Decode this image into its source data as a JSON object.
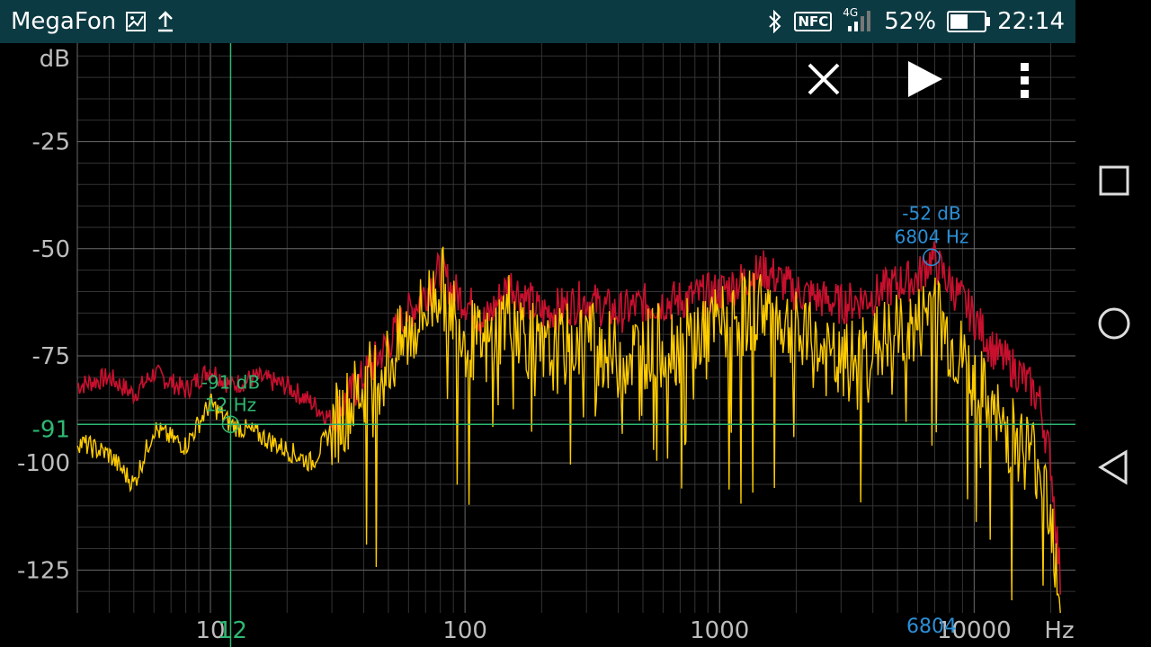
{
  "status_bar": {
    "carrier": "MegaFon",
    "network_type": "4G",
    "battery_percent": "52%",
    "battery_level": 0.52,
    "time": "22:14",
    "icons": [
      "image-icon",
      "upload-icon",
      "bluetooth-icon",
      "nfc-icon",
      "signal-icon",
      "battery-icon"
    ],
    "nfc_label": "NFC"
  },
  "toolbar": {
    "icons": [
      "close-icon",
      "play-icon",
      "more-vert-icon"
    ]
  },
  "nav_bar": {
    "icons": [
      "recents-square-icon",
      "home-circle-icon",
      "back-triangle-icon"
    ]
  },
  "colors": {
    "background": "#000000",
    "grid_major": "#6a6a6a",
    "grid_minor": "#333333",
    "peak_trace": "#c8102e",
    "live_trace": "#ffcc00",
    "cursor": "#2eb872",
    "peak_marker": "#2b8fd6",
    "axis_text": "#bdbdbd"
  },
  "cursor": {
    "db_label": "-91 dB",
    "hz_label": "12 Hz",
    "axis_db_label": "-91",
    "axis_hz_label": "12",
    "db": -91,
    "hz": 12
  },
  "peak_marker": {
    "db_label": "-52 dB",
    "hz_label": "6804 Hz",
    "axis_hz_label": "6804",
    "db": -52,
    "hz": 6804
  },
  "chart_data": {
    "type": "line",
    "y_unit": "dB",
    "x_unit": "Hz",
    "x_scale": "log",
    "xlim": [
      3,
      25000
    ],
    "ylim": [
      -135,
      -2
    ],
    "yticks": [
      -25,
      -50,
      -75,
      -100,
      -125
    ],
    "xticks": [
      10,
      100,
      1000,
      10000
    ],
    "series": [
      {
        "role": "peak_hold",
        "x": [
          3,
          4,
          5,
          6,
          8,
          10,
          12,
          15,
          20,
          25,
          30,
          40,
          50,
          60,
          70,
          80,
          90,
          100,
          120,
          150,
          200,
          300,
          400,
          500,
          700,
          1000,
          1500,
          2000,
          3000,
          4000,
          5000,
          6000,
          6804,
          8000,
          10000,
          12000,
          15000,
          18000,
          20000,
          22000
        ],
        "y": [
          -82,
          -80,
          -84,
          -79,
          -83,
          -78,
          -82,
          -80,
          -82,
          -86,
          -90,
          -80,
          -72,
          -65,
          -60,
          -55,
          -60,
          -62,
          -67,
          -58,
          -65,
          -62,
          -65,
          -63,
          -62,
          -60,
          -55,
          -60,
          -63,
          -61,
          -58,
          -57,
          -52,
          -58,
          -66,
          -74,
          -79,
          -85,
          -100,
          -130
        ]
      },
      {
        "role": "live",
        "x": [
          3,
          4,
          5,
          6,
          8,
          10,
          12,
          15,
          20,
          25,
          30,
          40,
          50,
          60,
          70,
          80,
          90,
          100,
          120,
          150,
          200,
          300,
          400,
          500,
          700,
          1000,
          1500,
          2000,
          3000,
          4000,
          5000,
          6000,
          6804,
          8000,
          10000,
          12000,
          15000,
          18000,
          20000,
          22000
        ],
        "y": [
          -95,
          -98,
          -105,
          -92,
          -96,
          -86,
          -91,
          -93,
          -97,
          -100,
          -92,
          -82,
          -77,
          -70,
          -64,
          -58,
          -64,
          -70,
          -74,
          -64,
          -76,
          -70,
          -76,
          -73,
          -72,
          -68,
          -63,
          -70,
          -78,
          -73,
          -70,
          -69,
          -62,
          -72,
          -80,
          -90,
          -95,
          -100,
          -110,
          -135
        ]
      }
    ]
  }
}
